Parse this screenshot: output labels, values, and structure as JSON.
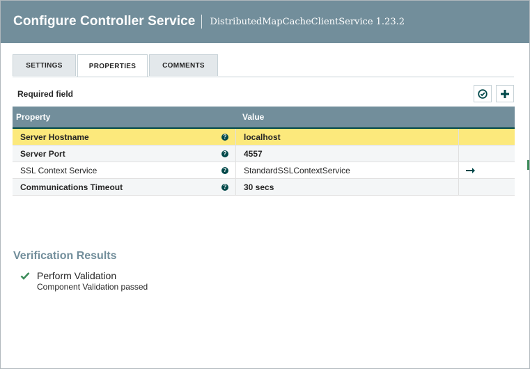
{
  "header": {
    "title": "Configure Controller Service",
    "subtitle": "DistributedMapCacheClientService 1.23.2"
  },
  "tabs": [
    {
      "label": "SETTINGS",
      "active": false
    },
    {
      "label": "PROPERTIES",
      "active": true
    },
    {
      "label": "COMMENTS",
      "active": false
    }
  ],
  "required_label": "Required field",
  "toolbar": {
    "verify_icon": "check-circle-icon",
    "add_icon": "plus-icon"
  },
  "table": {
    "columns": [
      "Property",
      "Value"
    ],
    "rows": [
      {
        "property": "Server Hostname",
        "value": "localhost",
        "required": true,
        "selected": true
      },
      {
        "property": "Server Port",
        "value": "4557",
        "required": true,
        "selected": false
      },
      {
        "property": "SSL Context Service",
        "value": "StandardSSLContextService",
        "required": false,
        "selected": false,
        "action_icon": "arrow-right-icon"
      },
      {
        "property": "Communications Timeout",
        "value": "30 secs",
        "required": true,
        "selected": false
      }
    ]
  },
  "verification": {
    "title": "Verification Results",
    "items": [
      {
        "title": "Perform Validation",
        "description": "Component Validation passed",
        "status": "success"
      }
    ]
  },
  "colors": {
    "header_bg": "#728e9b",
    "selected_row": "#fce97c",
    "success": "#3d8c5a",
    "help_icon": "#004849"
  }
}
